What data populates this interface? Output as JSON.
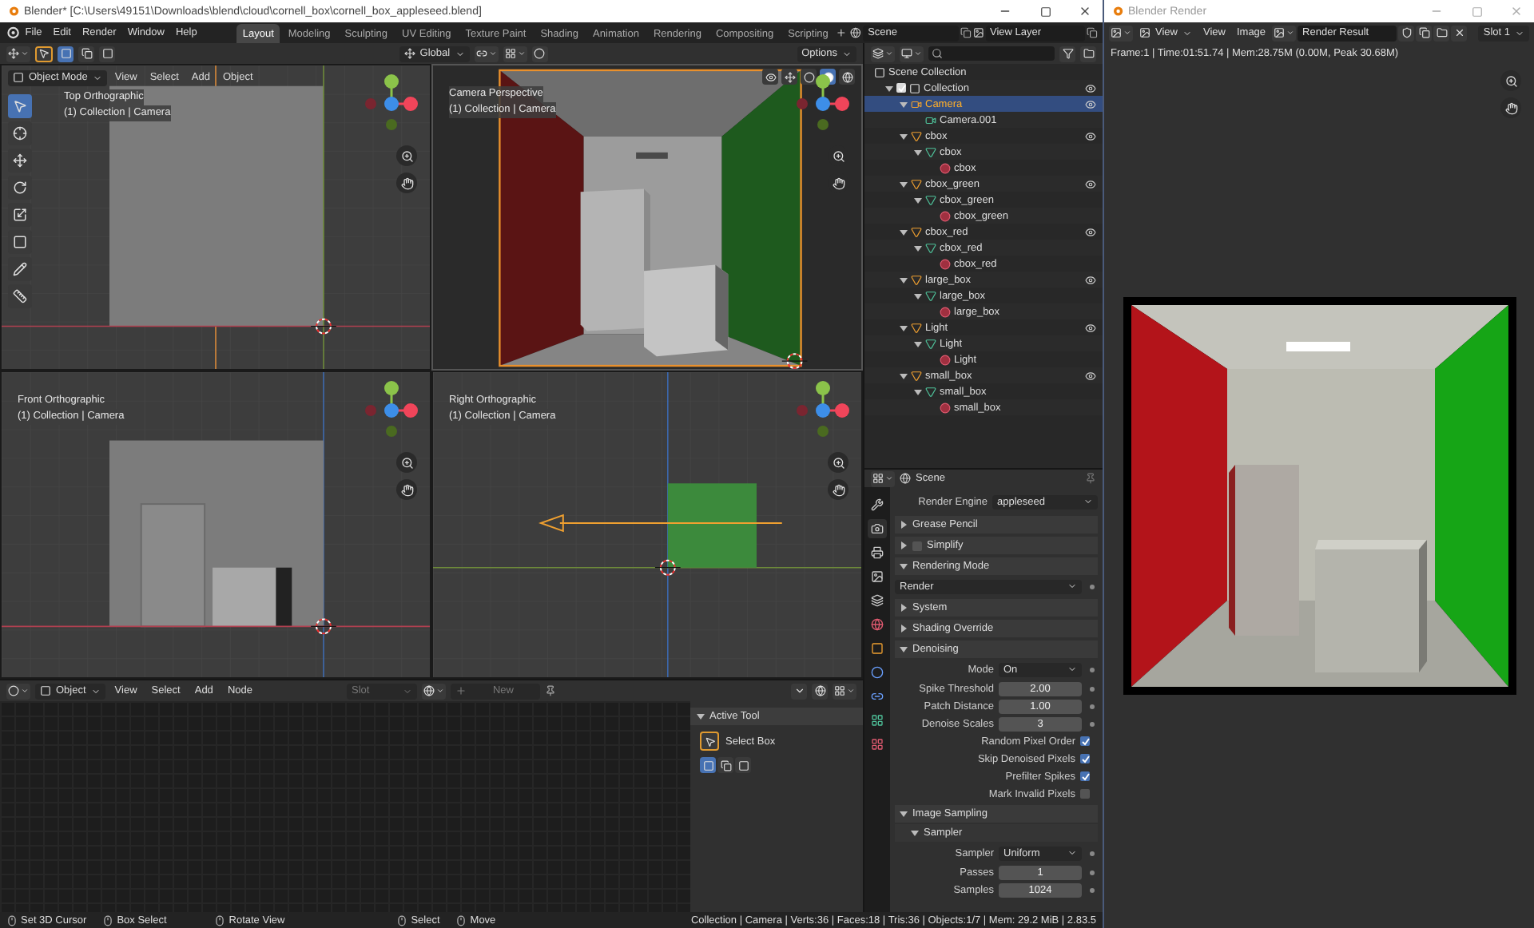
{
  "main_window": {
    "title": "Blender* [C:\\Users\\49151\\Downloads\\blend\\cloud\\cornell_box\\cornell_box_appleseed.blend]",
    "menu": [
      "File",
      "Edit",
      "Render",
      "Window",
      "Help"
    ],
    "workspaces": [
      {
        "label": "Layout",
        "selected": true
      },
      {
        "label": "Modeling",
        "selected": false
      },
      {
        "label": "Sculpting",
        "selected": false
      },
      {
        "label": "UV Editing",
        "selected": false
      },
      {
        "label": "Texture Paint",
        "selected": false
      },
      {
        "label": "Shading",
        "selected": false
      },
      {
        "label": "Animation",
        "selected": false
      },
      {
        "label": "Rendering",
        "selected": false
      },
      {
        "label": "Compositing",
        "selected": false
      },
      {
        "label": "Scripting",
        "selected": false
      }
    ],
    "scene": "Scene",
    "view_layer": "View Layer"
  },
  "viewport": {
    "orientation": "Global",
    "mode": "Object Mode",
    "menu": [
      "View",
      "Select",
      "Add",
      "Object"
    ],
    "options": "Options",
    "views": [
      {
        "kind": "top",
        "title": "Top Orthographic",
        "subtitle": "(1) Collection | Camera"
      },
      {
        "kind": "camera",
        "title": "Camera Perspective",
        "subtitle": "(1) Collection | Camera"
      },
      {
        "kind": "front",
        "title": "Front Orthographic",
        "subtitle": "(1) Collection | Camera"
      },
      {
        "kind": "right",
        "title": "Right Orthographic",
        "subtitle": "(1) Collection | Camera"
      }
    ]
  },
  "outliner": {
    "root": "Scene Collection",
    "items": [
      {
        "label": "Collection",
        "kind": "collection",
        "checked": true,
        "visible": true,
        "selected": false,
        "children": [
          {
            "label": "Camera",
            "kind": "camera_object",
            "visible": true,
            "selected": true,
            "children": [
              {
                "label": "Camera.001",
                "kind": "camera",
                "selected": false
              }
            ]
          },
          {
            "label": "cbox",
            "kind": "object",
            "visible": true,
            "selected": false,
            "children": [
              {
                "label": "cbox",
                "kind": "mesh",
                "selected": false,
                "children": [
                  {
                    "label": "cbox",
                    "kind": "material",
                    "selected": false
                  }
                ]
              }
            ]
          },
          {
            "label": "cbox_green",
            "kind": "object",
            "visible": true,
            "selected": false,
            "children": [
              {
                "label": "cbox_green",
                "kind": "mesh",
                "selected": false,
                "children": [
                  {
                    "label": "cbox_green",
                    "kind": "material",
                    "selected": false
                  }
                ]
              }
            ]
          },
          {
            "label": "cbox_red",
            "kind": "object",
            "visible": true,
            "selected": false,
            "children": [
              {
                "label": "cbox_red",
                "kind": "mesh",
                "selected": false,
                "children": [
                  {
                    "label": "cbox_red",
                    "kind": "material",
                    "selected": false
                  }
                ]
              }
            ]
          },
          {
            "label": "large_box",
            "kind": "object",
            "visible": true,
            "selected": false,
            "children": [
              {
                "label": "large_box",
                "kind": "mesh",
                "selected": false,
                "children": [
                  {
                    "label": "large_box",
                    "kind": "material",
                    "selected": false
                  }
                ]
              }
            ]
          },
          {
            "label": "Light",
            "kind": "object",
            "visible": true,
            "selected": false,
            "children": [
              {
                "label": "Light",
                "kind": "mesh",
                "selected": false,
                "children": [
                  {
                    "label": "Light",
                    "kind": "material",
                    "selected": false
                  }
                ]
              }
            ]
          },
          {
            "label": "small_box",
            "kind": "object",
            "visible": true,
            "selected": false,
            "children": [
              {
                "label": "small_box",
                "kind": "mesh",
                "selected": false,
                "children": [
                  {
                    "label": "small_box",
                    "kind": "material",
                    "selected": false
                  }
                ]
              }
            ]
          }
        ]
      }
    ]
  },
  "properties": {
    "context": "Scene",
    "render_engine": {
      "label": "Render Engine",
      "value": "appleseed"
    },
    "panels": [
      {
        "title": "Grease Pencil",
        "expanded": false
      },
      {
        "title": "Simplify",
        "expanded": false,
        "checked": false
      },
      {
        "title": "Rendering Mode",
        "expanded": true,
        "rows": [
          {
            "kind": "select",
            "value": "Render"
          }
        ]
      },
      {
        "title": "System",
        "expanded": false
      },
      {
        "title": "Shading Override",
        "expanded": false
      },
      {
        "title": "Denoising",
        "expanded": true,
        "rows": [
          {
            "kind": "select",
            "label": "Mode",
            "value": "On"
          },
          {
            "kind": "number",
            "label": "Spike Threshold",
            "value": "2.00"
          },
          {
            "kind": "number",
            "label": "Patch Distance",
            "value": "1.00"
          },
          {
            "kind": "number",
            "label": "Denoise Scales",
            "value": "3"
          },
          {
            "kind": "check",
            "label": "Random Pixel Order",
            "checked": true
          },
          {
            "kind": "check",
            "label": "Skip Denoised Pixels",
            "checked": true
          },
          {
            "kind": "check",
            "label": "Prefilter Spikes",
            "checked": true
          },
          {
            "kind": "check",
            "label": "Mark Invalid Pixels",
            "checked": false
          }
        ]
      },
      {
        "title": "Image Sampling",
        "expanded": true,
        "rows": [
          {
            "kind": "subpanel",
            "title": "Sampler",
            "expanded": true
          },
          {
            "kind": "select",
            "label": "Sampler",
            "value": "Uniform"
          },
          {
            "kind": "number",
            "label": "Passes",
            "value": "1"
          },
          {
            "kind": "number",
            "label": "Samples",
            "value": "1024"
          }
        ]
      }
    ]
  },
  "node_editor": {
    "editor": "Object",
    "menu": [
      "View",
      "Select",
      "Add",
      "Node"
    ],
    "slot": "Slot",
    "new": "New",
    "sidebar": {
      "title": "Active Tool",
      "tool": "Select Box"
    }
  },
  "status_bar": {
    "hints": [
      "Set 3D Cursor",
      "Box Select",
      "Rotate View",
      "Select",
      "Move"
    ],
    "stats": "Collection | Camera | Verts:36 | Faces:18 | Tris:36 | Objects:1/7 | Mem: 29.2 MiB | 2.83.5"
  },
  "render_window": {
    "title": "Blender Render",
    "view_menu": "View",
    "menu": [
      "View",
      "Image"
    ],
    "image": "Render Result",
    "slot": "Slot 1",
    "info": "Frame:1 | Time:01:51.74 | Mem:28.75M (0.00M, Peak 30.68M)"
  }
}
